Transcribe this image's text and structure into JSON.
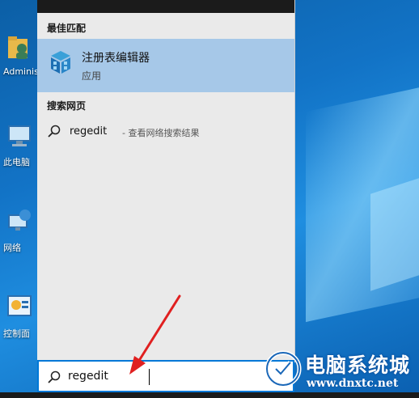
{
  "desktop": {
    "icons": [
      {
        "label": "Adminis"
      },
      {
        "label": "此电脑"
      },
      {
        "label": "网络"
      },
      {
        "label": "控制面"
      }
    ]
  },
  "search_results": {
    "best_match_header": "最佳匹配",
    "best_match": {
      "app_name": "注册表编辑器",
      "app_type": "应用"
    },
    "web_header": "搜索网页",
    "web_result": {
      "query": "regedit",
      "description": "- 查看网络搜索结果"
    }
  },
  "search_bar": {
    "value": "regedit"
  },
  "watermark": {
    "name": "电脑系统城",
    "url": "www.dnxtc.net"
  },
  "colors": {
    "accent": "#0078d7",
    "selected": "#a6c8e8",
    "annotation_arrow": "#e02020"
  }
}
